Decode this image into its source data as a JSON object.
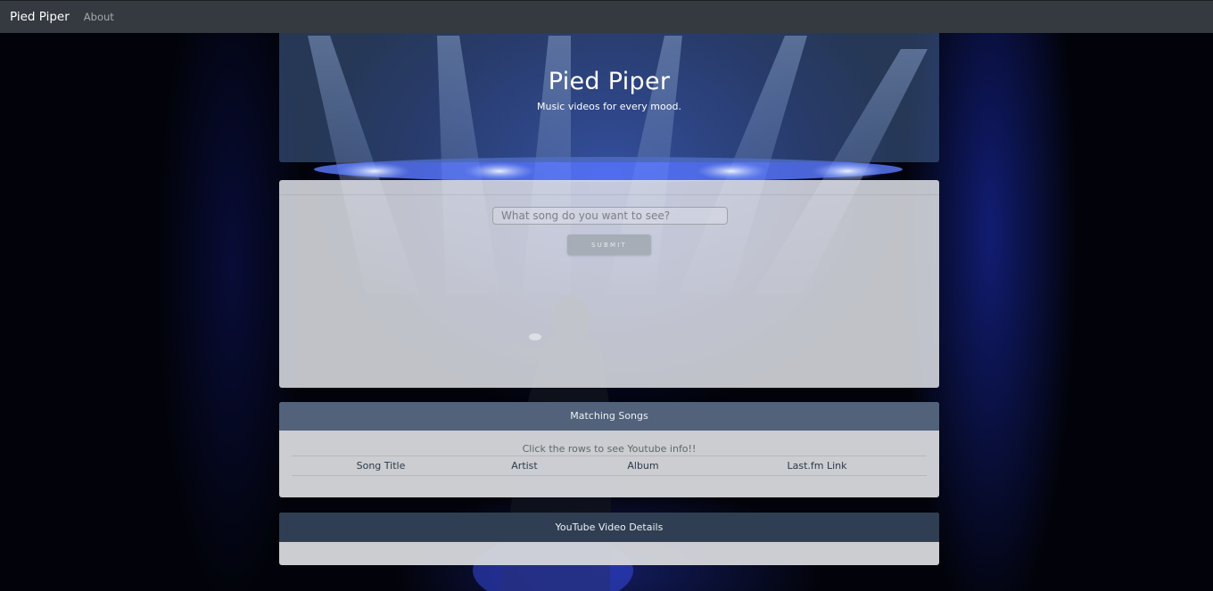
{
  "navbar": {
    "brand": "Pied Piper",
    "links": [
      "About"
    ]
  },
  "jumbotron": {
    "title": "Pied Piper",
    "subtitle": "Music videos for every mood."
  },
  "search": {
    "placeholder": "What song do you want to see?",
    "value": "",
    "submit_label": "Submit"
  },
  "results": {
    "header": "Matching Songs",
    "hint": "Click the rows to see Youtube info!!",
    "columns": [
      "Song Title",
      "Artist",
      "Album",
      "Last.fm Link"
    ],
    "rows": []
  },
  "video": {
    "header": "YouTube Video Details"
  },
  "colors": {
    "navbar_bg": "#343a40",
    "card_header": "#51627a",
    "video_header": "#2f3e52",
    "submit_button": "#a6adb6"
  }
}
